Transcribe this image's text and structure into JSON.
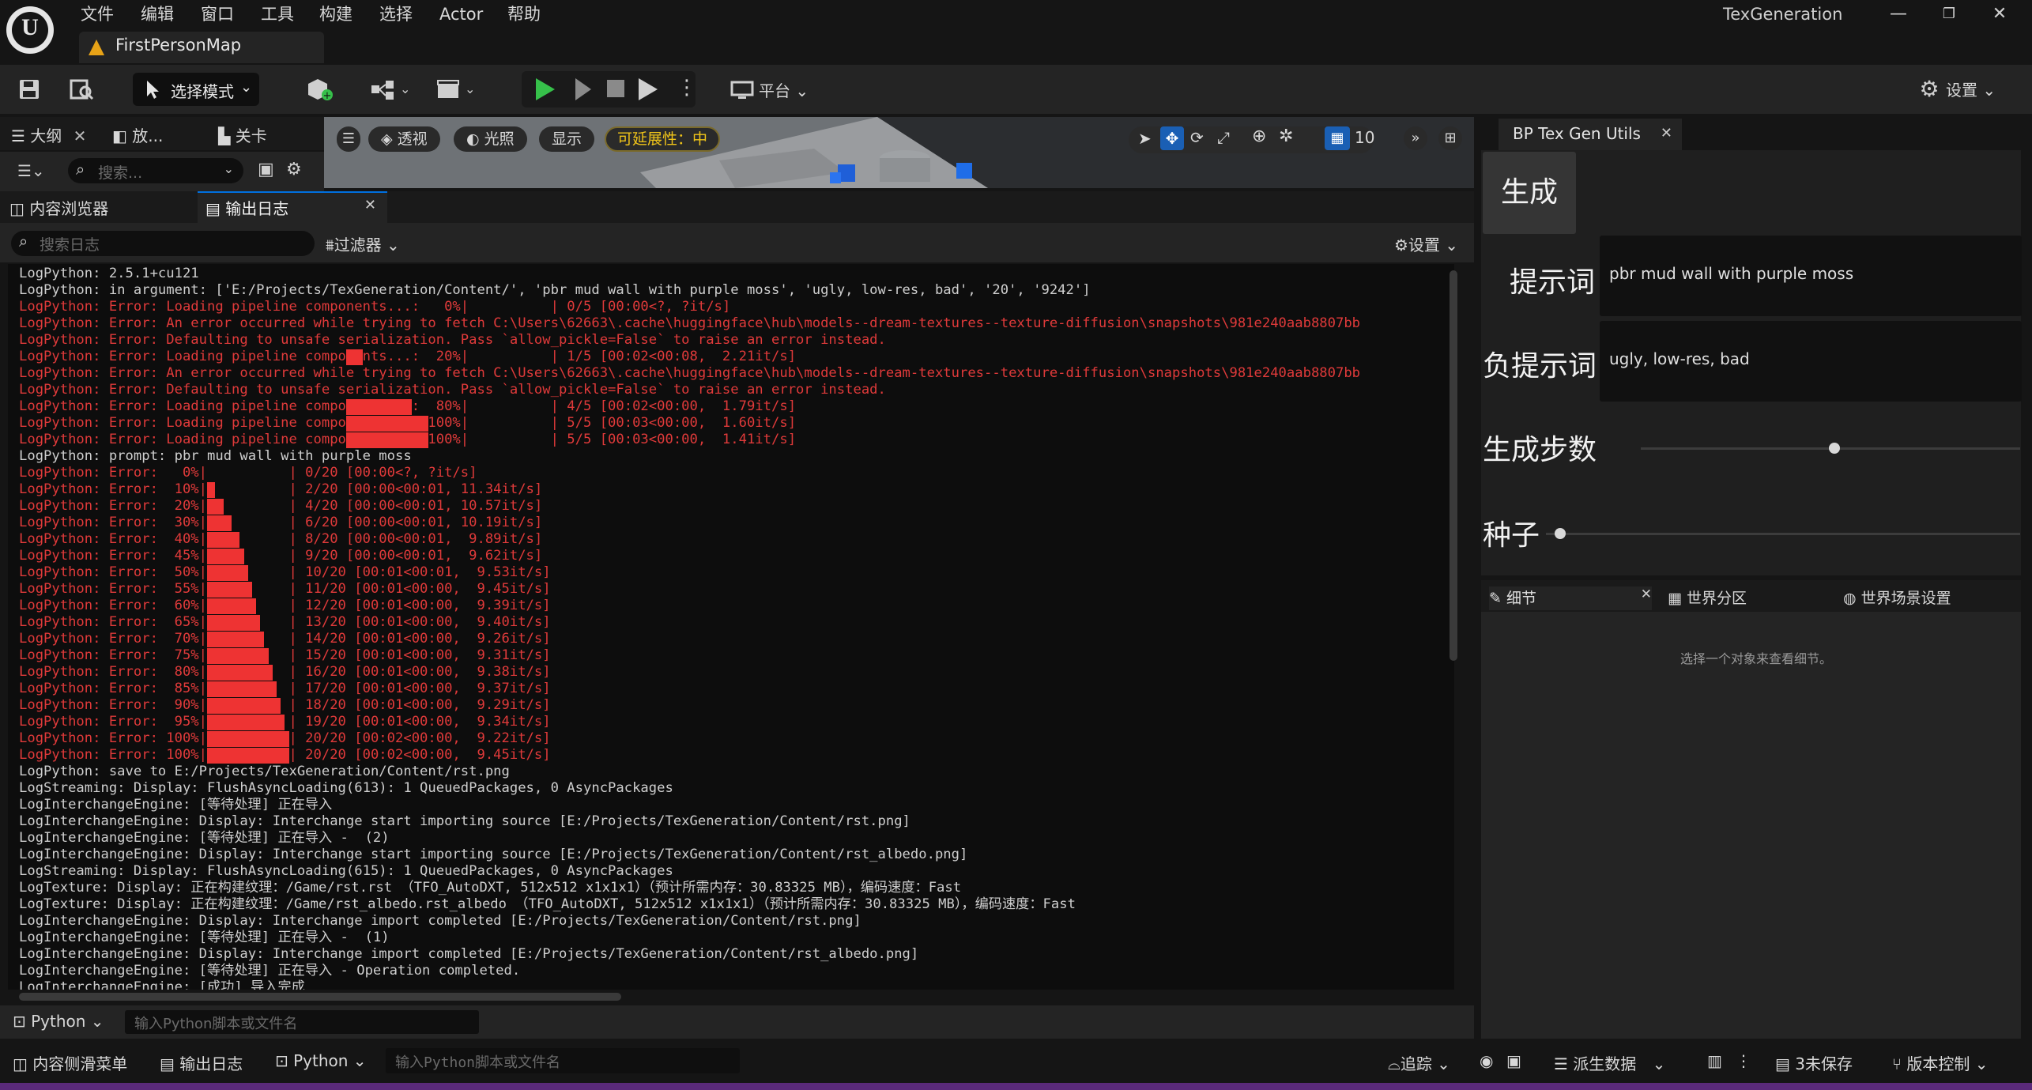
{
  "window": {
    "logo_text": "U",
    "menu": [
      "文件",
      "编辑",
      "窗口",
      "工具",
      "构建",
      "选择",
      "Actor",
      "帮助"
    ],
    "level_tab": "FirstPersonMap",
    "title": "TexGeneration",
    "controls": [
      "—",
      "❐",
      "✕"
    ]
  },
  "toolbar": {
    "mode_label": "选择模式",
    "platform_label": "平台",
    "settings_label": "设置"
  },
  "left_tabs": {
    "outline": "大纲",
    "place": "放...",
    "level": "关卡",
    "search_placeholder": "搜索..."
  },
  "viewport": {
    "perspective": "透视",
    "lighting": "光照",
    "show": "显示",
    "scalability": "可延展性：中",
    "grid_value": "10"
  },
  "log_tabs": {
    "content_browser": "内容浏览器",
    "output_log": "输出日志",
    "search_placeholder": "搜索日志",
    "filter_label": "过滤器",
    "settings_label": "设置"
  },
  "log_lines": [
    {
      "t": "LogPython: 2.5.1+cu121",
      "err": false,
      "bar": 0
    },
    {
      "t": "LogPython: in argument: ['E:/Projects/TexGeneration/Content/', 'pbr mud wall with purple moss', 'ugly, low-res, bad', '20', '9242']",
      "err": false,
      "bar": 0
    },
    {
      "t": "LogPython: Error: Loading pipeline components...:   0%|          | 0/5 [00:00<?, ?it/s]",
      "err": true,
      "bar": 0
    },
    {
      "t": "LogPython: Error: An error occurred while trying to fetch C:\\Users\\62663\\.cache\\huggingface\\hub\\models--dream-textures--texture-diffusion\\snapshots\\981e240aab8807bb",
      "err": true,
      "bar": 0
    },
    {
      "t": "LogPython: Error: Defaulting to unsafe serialization. Pass `allow_pickle=False` to raise an error instead.",
      "err": true,
      "bar": 0
    },
    {
      "t": "LogPython: Error: Loading pipeline components...:  20%|          | 1/5 [00:02<00:08,  2.21it/s]",
      "err": true,
      "bar": 0.2,
      "barcol": 40
    },
    {
      "t": "LogPython: Error: An error occurred while trying to fetch C:\\Users\\62663\\.cache\\huggingface\\hub\\models--dream-textures--texture-diffusion\\snapshots\\981e240aab8807bb",
      "err": true,
      "bar": 0
    },
    {
      "t": "LogPython: Error: Defaulting to unsafe serialization. Pass `allow_pickle=False` to raise an error instead.",
      "err": true,
      "bar": 0
    },
    {
      "t": "LogPython: Error: Loading pipeline components...:  80%|          | 4/5 [00:02<00:00,  1.79it/s]",
      "err": true,
      "bar": 0.8,
      "barcol": 40
    },
    {
      "t": "LogPython: Error: Loading pipeline components...: 100%|          | 5/5 [00:03<00:00,  1.60it/s]",
      "err": true,
      "bar": 1.0,
      "barcol": 40
    },
    {
      "t": "LogPython: Error: Loading pipeline components...: 100%|          | 5/5 [00:03<00:00,  1.41it/s]",
      "err": true,
      "bar": 1.0,
      "barcol": 40
    },
    {
      "t": "LogPython: prompt: pbr mud wall with purple moss",
      "err": false,
      "bar": 0
    },
    {
      "t": "LogPython: Error:   0%|          | 0/20 [00:00<?, ?it/s]",
      "err": true,
      "bar": 0
    },
    {
      "t": "LogPython: Error:  10%|          | 2/20 [00:00<00:01, 11.34it/s]",
      "err": true,
      "bar": 0.1,
      "barcol": 23
    },
    {
      "t": "LogPython: Error:  20%|          | 4/20 [00:00<00:01, 10.57it/s]",
      "err": true,
      "bar": 0.2,
      "barcol": 23
    },
    {
      "t": "LogPython: Error:  30%|          | 6/20 [00:00<00:01, 10.19it/s]",
      "err": true,
      "bar": 0.3,
      "barcol": 23
    },
    {
      "t": "LogPython: Error:  40%|          | 8/20 [00:00<00:01,  9.89it/s]",
      "err": true,
      "bar": 0.4,
      "barcol": 23
    },
    {
      "t": "LogPython: Error:  45%|          | 9/20 [00:00<00:01,  9.62it/s]",
      "err": true,
      "bar": 0.45,
      "barcol": 23
    },
    {
      "t": "LogPython: Error:  50%|          | 10/20 [00:01<00:01,  9.53it/s]",
      "err": true,
      "bar": 0.5,
      "barcol": 23
    },
    {
      "t": "LogPython: Error:  55%|          | 11/20 [00:01<00:00,  9.45it/s]",
      "err": true,
      "bar": 0.55,
      "barcol": 23
    },
    {
      "t": "LogPython: Error:  60%|          | 12/20 [00:01<00:00,  9.39it/s]",
      "err": true,
      "bar": 0.6,
      "barcol": 23
    },
    {
      "t": "LogPython: Error:  65%|          | 13/20 [00:01<00:00,  9.40it/s]",
      "err": true,
      "bar": 0.65,
      "barcol": 23
    },
    {
      "t": "LogPython: Error:  70%|          | 14/20 [00:01<00:00,  9.26it/s]",
      "err": true,
      "bar": 0.7,
      "barcol": 23
    },
    {
      "t": "LogPython: Error:  75%|          | 15/20 [00:01<00:00,  9.31it/s]",
      "err": true,
      "bar": 0.75,
      "barcol": 23
    },
    {
      "t": "LogPython: Error:  80%|          | 16/20 [00:01<00:00,  9.38it/s]",
      "err": true,
      "bar": 0.8,
      "barcol": 23
    },
    {
      "t": "LogPython: Error:  85%|          | 17/20 [00:01<00:00,  9.37it/s]",
      "err": true,
      "bar": 0.85,
      "barcol": 23
    },
    {
      "t": "LogPython: Error:  90%|          | 18/20 [00:01<00:00,  9.29it/s]",
      "err": true,
      "bar": 0.9,
      "barcol": 23
    },
    {
      "t": "LogPython: Error:  95%|          | 19/20 [00:01<00:00,  9.34it/s]",
      "err": true,
      "bar": 0.95,
      "barcol": 23
    },
    {
      "t": "LogPython: Error: 100%|          | 20/20 [00:02<00:00,  9.22it/s]",
      "err": true,
      "bar": 1.0,
      "barcol": 23
    },
    {
      "t": "LogPython: Error: 100%|          | 20/20 [00:02<00:00,  9.45it/s]",
      "err": true,
      "bar": 1.0,
      "barcol": 23
    },
    {
      "t": "LogPython: save to E:/Projects/TexGeneration/Content/rst.png",
      "err": false,
      "bar": 0
    },
    {
      "t": "LogStreaming: Display: FlushAsyncLoading(613): 1 QueuedPackages, 0 AsyncPackages",
      "err": false,
      "bar": 0
    },
    {
      "t": "LogInterchangeEngine: [等待处理] 正在导入",
      "err": false,
      "bar": 0
    },
    {
      "t": "LogInterchangeEngine: Display: Interchange start importing source [E:/Projects/TexGeneration/Content/rst.png]",
      "err": false,
      "bar": 0
    },
    {
      "t": "LogInterchangeEngine: [等待处理] 正在导入 -  (2)",
      "err": false,
      "bar": 0
    },
    {
      "t": "LogInterchangeEngine: Display: Interchange start importing source [E:/Projects/TexGeneration/Content/rst_albedo.png]",
      "err": false,
      "bar": 0
    },
    {
      "t": "LogStreaming: Display: FlushAsyncLoading(615): 1 QueuedPackages, 0 AsyncPackages",
      "err": false,
      "bar": 0
    },
    {
      "t": "LogTexture: Display: 正在构建纹理：/Game/rst.rst （TFO_AutoDXT, 512x512 x1x1x1）（预计所需内存：30.83325 MB），编码速度：Fast",
      "err": false,
      "bar": 0
    },
    {
      "t": "LogTexture: Display: 正在构建纹理：/Game/rst_albedo.rst_albedo （TFO_AutoDXT, 512x512 x1x1x1）（预计所需内存：30.83325 MB），编码速度：Fast",
      "err": false,
      "bar": 0
    },
    {
      "t": "LogInterchangeEngine: Display: Interchange import completed [E:/Projects/TexGeneration/Content/rst.png]",
      "err": false,
      "bar": 0
    },
    {
      "t": "LogInterchangeEngine: [等待处理] 正在导入 -  (1)",
      "err": false,
      "bar": 0
    },
    {
      "t": "LogInterchangeEngine: Display: Interchange import completed [E:/Projects/TexGeneration/Content/rst_albedo.png]",
      "err": false,
      "bar": 0
    },
    {
      "t": "LogInterchangeEngine: [等待处理] 正在导入 - Operation completed.",
      "err": false,
      "bar": 0
    },
    {
      "t": "LogInterchangeEngine: [成功] 导入完成",
      "err": false,
      "bar": 0
    }
  ],
  "cmd": {
    "type_label": "Python",
    "placeholder": "输入Python脚本或文件名"
  },
  "bp_panel": {
    "tab_title": "BP Tex Gen Utils",
    "generate_label": "生成",
    "prompt_label": "提示词",
    "prompt_value": "pbr mud wall with purple moss",
    "negative_label": "负提示词",
    "negative_value": "ugly, low-res, bad",
    "steps_label": "生成步数",
    "steps_level": 0.51,
    "seed_label": "种子",
    "seed_level": 0.03
  },
  "details": {
    "tab_details": "细节",
    "tab_world_partition": "世界分区",
    "tab_world_settings": "世界场景设置",
    "hint": "选择一个对象来查看细节。"
  },
  "statusbar": {
    "content_drawer": "内容侧滑菜单",
    "output_log": "输出日志",
    "python": "Python",
    "placeholder": "输入Python脚本或文件名",
    "trace": "追踪",
    "derived_data": "派生数据",
    "unsaved": "3未保存",
    "source_control": "版本控制"
  },
  "colors": {
    "accent_blue": "#0070e0",
    "error_red": "#e03a3a",
    "progress_red": "#ee3333",
    "play_green": "#36c04a",
    "scalability_yellow": "#f0c419"
  }
}
